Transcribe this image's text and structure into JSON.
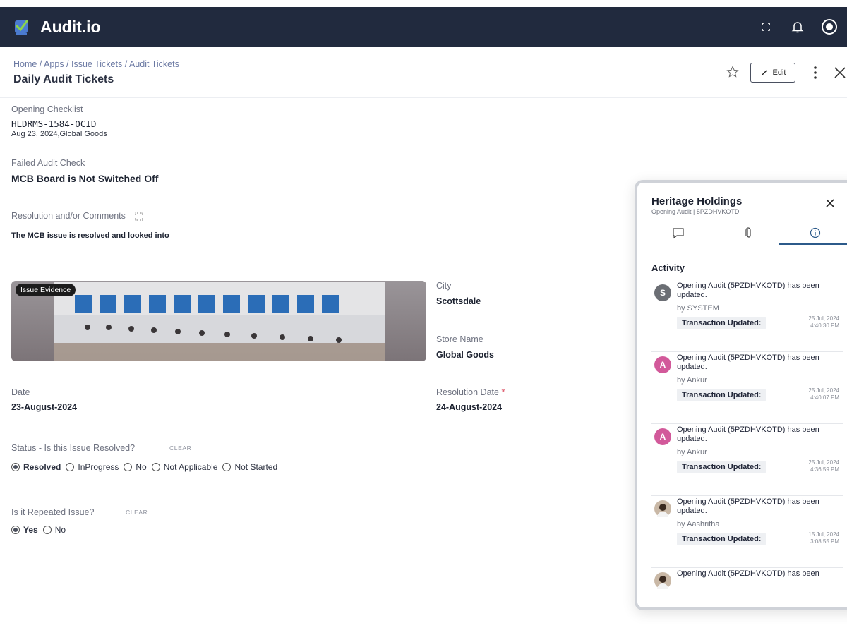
{
  "app": {
    "title": "Audit.io"
  },
  "header": {
    "breadcrumb": "Home / Apps / Issue Tickets / Audit Tickets",
    "title": "Daily Audit Tickets",
    "edit_label": "Edit"
  },
  "ticket": {
    "checklist_label": "Opening Checklist",
    "checklist_id": "HLDRMS-1584-OCID",
    "checklist_meta": "Aug 23, 2024,Global Goods",
    "failed_label": "Failed Audit Check",
    "failed_value": "MCB Board is Not Switched Off",
    "comments_label": "Resolution and/or Comments",
    "comments_value": "The MCB issue is resolved and looked into",
    "evidence_label": "Issue Evidence",
    "city_label": "City",
    "city_value": "Scottsdale",
    "store_label": "Store Name",
    "store_value": "Global Goods",
    "date_label": "Date",
    "date_value": "23-August-2024",
    "resolution_date_label": "Resolution Date",
    "resolution_date_required": "*",
    "resolution_date_value": "24-August-2024",
    "status_label": "Status - Is this Issue Resolved?",
    "status_clear": "CLEAR",
    "status_options": [
      "Resolved",
      "InProgress",
      "No",
      "Not Applicable",
      "Not Started"
    ],
    "status_selected": "Resolved",
    "repeated_label": "Is it Repeated Issue?",
    "repeated_clear": "CLEAR",
    "repeated_options": [
      "Yes",
      "No"
    ],
    "repeated_selected": "Yes"
  },
  "panel": {
    "title": "Heritage Holdings",
    "subtitle": "Opening Audit | 5PZDHVKOTD",
    "activity_heading": "Activity",
    "activities": [
      {
        "initial": "S",
        "color": "#6b6e74",
        "message": "Opening Audit (5PZDHVKOTD) has been updated.",
        "by": "by SYSTEM",
        "chip": "Transaction Updated:",
        "date": "25 Jul, 2024",
        "time": "4:40:30 PM"
      },
      {
        "initial": "A",
        "color": "#d2599a",
        "message": "Opening Audit (5PZDHVKOTD) has been updated.",
        "by": "by Ankur",
        "chip": "Transaction Updated:",
        "date": "25 Jul, 2024",
        "time": "4:40:07 PM"
      },
      {
        "initial": "A",
        "color": "#d2599a",
        "message": "Opening Audit (5PZDHVKOTD) has been updated.",
        "by": "by Ankur",
        "chip": "Transaction Updated:",
        "date": "25 Jul, 2024",
        "time": "4:36:59 PM"
      },
      {
        "initial": "",
        "color": "#c9b8a6",
        "message": "Opening Audit (5PZDHVKOTD) has been updated.",
        "by": "by Aashritha",
        "chip": "Transaction Updated:",
        "date": "15 Jul, 2024",
        "time": "3:08:55 PM"
      },
      {
        "initial": "",
        "color": "#c9b8a6",
        "message": "Opening Audit (5PZDHVKOTD) has been",
        "by": "",
        "chip": "",
        "date": "",
        "time": ""
      }
    ]
  },
  "colors": {
    "topbar": "#212a3e",
    "accent": "#2c5a8a",
    "required": "#d6344a"
  }
}
